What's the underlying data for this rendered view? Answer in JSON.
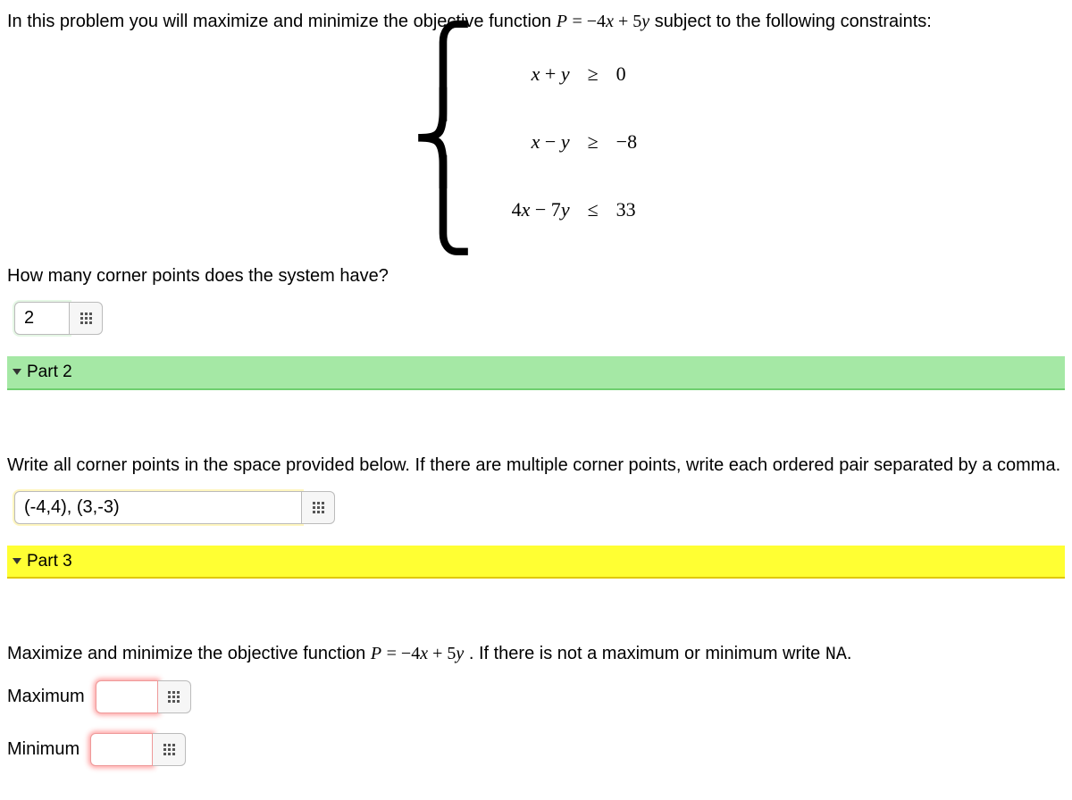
{
  "intro": {
    "prefix": "In this problem you will maximize and minimize the objective function ",
    "obj_var": "P",
    "eq": " = ",
    "obj_expr": "−4x + 5y",
    "suffix": "  subject to the following constraints:"
  },
  "constraints": [
    {
      "lhs": "x + y",
      "rel": "≥",
      "rhs": "0"
    },
    {
      "lhs": "x − y",
      "rel": "≥",
      "rhs": "−8"
    },
    {
      "lhs": "4x − 7y",
      "rel": "≤",
      "rhs": "33"
    }
  ],
  "part1": {
    "question": "How many corner points does the system have?",
    "answer": "2"
  },
  "part2": {
    "header": "Part 2",
    "question": "Write all corner points in the space provided below. If there are multiple corner points, write each ordered pair separated by a comma.",
    "answer": "(-4,4), (3,-3)"
  },
  "part3": {
    "header": "Part 3",
    "question_prefix": "Maximize and minimize the objective function ",
    "obj_var": "P",
    "eq": " = ",
    "obj_expr": "−4x + 5y",
    "question_suffix": ". If there is not a maximum or minimum write ",
    "na_token": "NA",
    "period": ".",
    "max_label": "Maximum",
    "min_label": "Minimum",
    "max_value": "",
    "min_value": ""
  }
}
